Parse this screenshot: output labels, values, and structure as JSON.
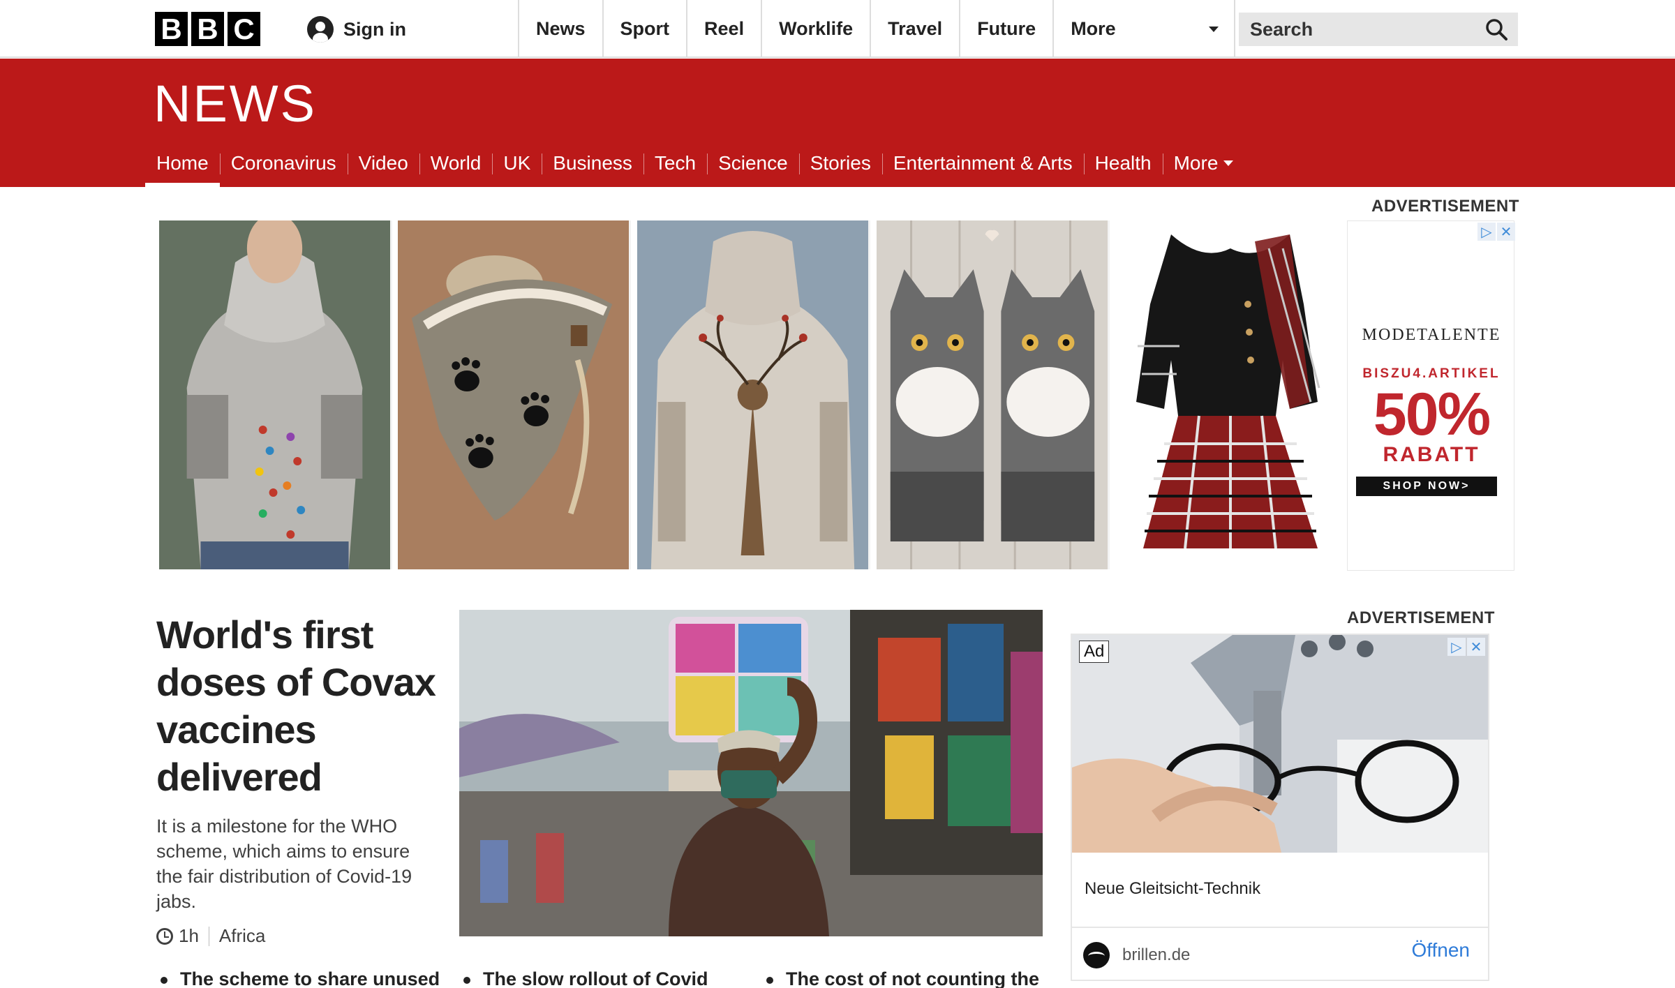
{
  "topbar": {
    "logo_letters": [
      "B",
      "B",
      "C"
    ],
    "signin_label": "Sign in",
    "nav": [
      "News",
      "Sport",
      "Reel",
      "Worklife",
      "Travel",
      "Future"
    ],
    "more_label": "More",
    "search_placeholder": "Search"
  },
  "news": {
    "logo": "NEWS",
    "subnav": [
      "Home",
      "Coronavirus",
      "Video",
      "World",
      "UK",
      "Business",
      "Tech",
      "Science",
      "Stories",
      "Entertainment & Arts",
      "Health"
    ],
    "subnav_more": "More",
    "active": "Home"
  },
  "top_ad": {
    "label": "ADVERTISEMENT",
    "brand": "MODETALENTE",
    "offer_line": "BISZU4.ARTIKEL",
    "percent": "50%",
    "rabatt": "RABATT",
    "cta": "SHOP NOW>"
  },
  "main": {
    "headline": "World's first doses of Covax vaccines delivered",
    "summary": "It is a milestone for the WHO scheme, which aims to ensure the fair distribution of Covid-19 jabs.",
    "time": "1h",
    "region": "Africa",
    "related": [
      "The scheme to share unused",
      "The slow rollout of Covid",
      "The cost of not counting the"
    ]
  },
  "side_ad": {
    "label": "ADVERTISEMENT",
    "tag": "Ad",
    "title": "Neue Gleitsicht-Technik",
    "advertiser": "brillen.de",
    "cta": "Öffnen"
  },
  "colors": {
    "news_red": "#bb1919",
    "search_bg": "#e6e6e6",
    "link_blue": "#2e7bd8"
  }
}
